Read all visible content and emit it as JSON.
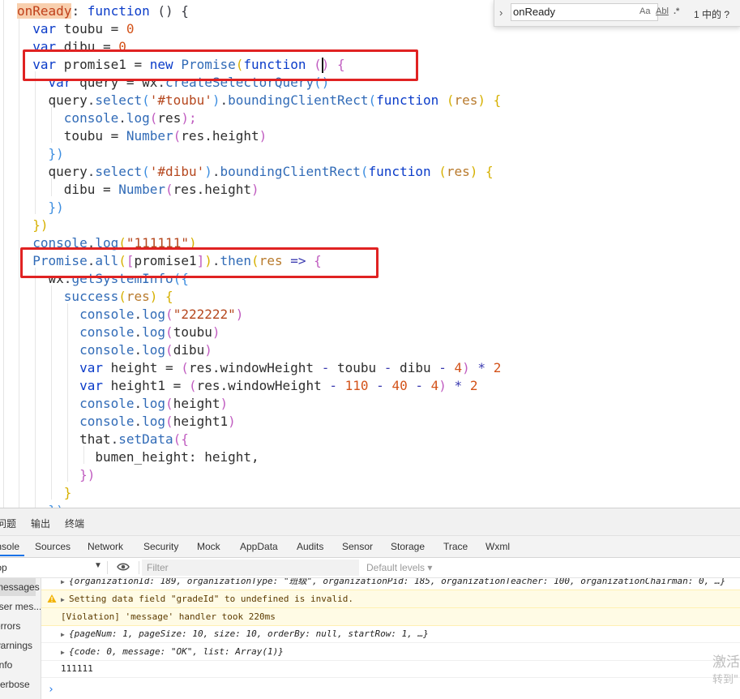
{
  "editor": {
    "lines": [
      [
        {
          "t": "onReady",
          "c": "hl"
        },
        {
          "t": ": ",
          "c": "punc"
        },
        {
          "t": "function",
          "c": "kw"
        },
        {
          "t": " () {",
          "c": "punc"
        }
      ],
      [
        {
          "t": "  ",
          "c": "punc"
        },
        {
          "t": "var",
          "c": "kw"
        },
        {
          "t": " toubu = ",
          "c": "var"
        },
        {
          "t": "0",
          "c": "num"
        }
      ],
      [
        {
          "t": "  ",
          "c": "punc"
        },
        {
          "t": "var",
          "c": "kw"
        },
        {
          "t": " dibu = ",
          "c": "var"
        },
        {
          "t": "0",
          "c": "num"
        }
      ],
      [
        {
          "t": "  ",
          "c": "punc"
        },
        {
          "t": "var",
          "c": "kw"
        },
        {
          "t": " promise1 = ",
          "c": "var"
        },
        {
          "t": "new",
          "c": "kw"
        },
        {
          "t": " ",
          "c": "punc"
        },
        {
          "t": "Promise",
          "c": "fn"
        },
        {
          "t": "(",
          "c": "br1"
        },
        {
          "t": "function",
          "c": "kw"
        },
        {
          "t": " (",
          "c": "br2"
        },
        {
          "t": "CURSOR",
          "c": "cursor"
        },
        {
          "t": ")",
          "c": "br2"
        },
        {
          "t": " {",
          "c": "br2"
        }
      ],
      [
        {
          "t": "    ",
          "c": "punc"
        },
        {
          "t": "var",
          "c": "kw"
        },
        {
          "t": " query = ",
          "c": "var"
        },
        {
          "t": "wx",
          "c": "var"
        },
        {
          "t": ".",
          "c": "punc"
        },
        {
          "t": "createSelectorQuery",
          "c": "fn"
        },
        {
          "t": "()",
          "c": "br3"
        }
      ],
      [
        {
          "t": "    ",
          "c": "punc"
        },
        {
          "t": "query",
          "c": "var"
        },
        {
          "t": ".",
          "c": "punc"
        },
        {
          "t": "select",
          "c": "fn"
        },
        {
          "t": "(",
          "c": "br3"
        },
        {
          "t": "'#toubu'",
          "c": "str"
        },
        {
          "t": ")",
          "c": "br3"
        },
        {
          "t": ".",
          "c": "punc"
        },
        {
          "t": "boundingClientRect",
          "c": "fn"
        },
        {
          "t": "(",
          "c": "br3"
        },
        {
          "t": "function",
          "c": "kw"
        },
        {
          "t": " (",
          "c": "br1"
        },
        {
          "t": "res",
          "c": "prm"
        },
        {
          "t": ")",
          "c": "br1"
        },
        {
          "t": " {",
          "c": "br1"
        }
      ],
      [
        {
          "t": "      ",
          "c": "punc"
        },
        {
          "t": "console",
          "c": "fn"
        },
        {
          "t": ".",
          "c": "punc"
        },
        {
          "t": "log",
          "c": "fn"
        },
        {
          "t": "(",
          "c": "br2"
        },
        {
          "t": "res",
          "c": "var"
        },
        {
          "t": ");",
          "c": "br2"
        }
      ],
      [
        {
          "t": "      ",
          "c": "punc"
        },
        {
          "t": "toubu = ",
          "c": "var"
        },
        {
          "t": "Number",
          "c": "fn"
        },
        {
          "t": "(",
          "c": "br2"
        },
        {
          "t": "res.height",
          "c": "var"
        },
        {
          "t": ")",
          "c": "br2"
        }
      ],
      [
        {
          "t": "    ",
          "c": "punc"
        },
        {
          "t": "})",
          "c": "br3"
        }
      ],
      [
        {
          "t": "    ",
          "c": "punc"
        },
        {
          "t": "query",
          "c": "var"
        },
        {
          "t": ".",
          "c": "punc"
        },
        {
          "t": "select",
          "c": "fn"
        },
        {
          "t": "(",
          "c": "br3"
        },
        {
          "t": "'#dibu'",
          "c": "str"
        },
        {
          "t": ")",
          "c": "br3"
        },
        {
          "t": ".",
          "c": "punc"
        },
        {
          "t": "boundingClientRect",
          "c": "fn"
        },
        {
          "t": "(",
          "c": "br3"
        },
        {
          "t": "function",
          "c": "kw"
        },
        {
          "t": " (",
          "c": "br1"
        },
        {
          "t": "res",
          "c": "prm"
        },
        {
          "t": ")",
          "c": "br1"
        },
        {
          "t": " {",
          "c": "br1"
        }
      ],
      [
        {
          "t": "      ",
          "c": "punc"
        },
        {
          "t": "dibu = ",
          "c": "var"
        },
        {
          "t": "Number",
          "c": "fn"
        },
        {
          "t": "(",
          "c": "br2"
        },
        {
          "t": "res.height",
          "c": "var"
        },
        {
          "t": ")",
          "c": "br2"
        }
      ],
      [
        {
          "t": "    ",
          "c": "punc"
        },
        {
          "t": "})",
          "c": "br3"
        }
      ],
      [
        {
          "t": "  ",
          "c": "punc"
        },
        {
          "t": "})",
          "c": "br1"
        }
      ],
      [
        {
          "t": "  ",
          "c": "punc"
        },
        {
          "t": "console",
          "c": "fn"
        },
        {
          "t": ".",
          "c": "punc"
        },
        {
          "t": "log",
          "c": "fn"
        },
        {
          "t": "(",
          "c": "br1"
        },
        {
          "t": "\"111111\"",
          "c": "str"
        },
        {
          "t": ")",
          "c": "br1"
        }
      ],
      [
        {
          "t": "  ",
          "c": "punc"
        },
        {
          "t": "Promise",
          "c": "fn"
        },
        {
          "t": ".",
          "c": "punc"
        },
        {
          "t": "all",
          "c": "fn"
        },
        {
          "t": "(",
          "c": "br1"
        },
        {
          "t": "[",
          "c": "br2"
        },
        {
          "t": "promise1",
          "c": "var"
        },
        {
          "t": "]",
          "c": "br2"
        },
        {
          "t": ")",
          "c": "br1"
        },
        {
          "t": ".",
          "c": "punc"
        },
        {
          "t": "then",
          "c": "fn"
        },
        {
          "t": "(",
          "c": "br1"
        },
        {
          "t": "res",
          "c": "prm"
        },
        {
          "t": " => ",
          "c": "op"
        },
        {
          "t": "{",
          "c": "br2"
        }
      ],
      [
        {
          "t": "    ",
          "c": "punc"
        },
        {
          "t": "wx",
          "c": "var"
        },
        {
          "t": ".",
          "c": "punc"
        },
        {
          "t": "getSystemInfo",
          "c": "fn"
        },
        {
          "t": "({",
          "c": "br3"
        }
      ],
      [
        {
          "t": "      ",
          "c": "punc"
        },
        {
          "t": "success",
          "c": "fn"
        },
        {
          "t": "(",
          "c": "br1"
        },
        {
          "t": "res",
          "c": "prm"
        },
        {
          "t": ")",
          "c": "br1"
        },
        {
          "t": " {",
          "c": "br1"
        }
      ],
      [
        {
          "t": "        ",
          "c": "punc"
        },
        {
          "t": "console",
          "c": "fn"
        },
        {
          "t": ".",
          "c": "punc"
        },
        {
          "t": "log",
          "c": "fn"
        },
        {
          "t": "(",
          "c": "br2"
        },
        {
          "t": "\"222222\"",
          "c": "str"
        },
        {
          "t": ")",
          "c": "br2"
        }
      ],
      [
        {
          "t": "        ",
          "c": "punc"
        },
        {
          "t": "console",
          "c": "fn"
        },
        {
          "t": ".",
          "c": "punc"
        },
        {
          "t": "log",
          "c": "fn"
        },
        {
          "t": "(",
          "c": "br2"
        },
        {
          "t": "toubu",
          "c": "var"
        },
        {
          "t": ")",
          "c": "br2"
        }
      ],
      [
        {
          "t": "        ",
          "c": "punc"
        },
        {
          "t": "console",
          "c": "fn"
        },
        {
          "t": ".",
          "c": "punc"
        },
        {
          "t": "log",
          "c": "fn"
        },
        {
          "t": "(",
          "c": "br2"
        },
        {
          "t": "dibu",
          "c": "var"
        },
        {
          "t": ")",
          "c": "br2"
        }
      ],
      [
        {
          "t": "        ",
          "c": "punc"
        },
        {
          "t": "var",
          "c": "kw"
        },
        {
          "t": " height = ",
          "c": "var"
        },
        {
          "t": "(",
          "c": "br2"
        },
        {
          "t": "res.windowHeight ",
          "c": "var"
        },
        {
          "t": "-",
          "c": "op"
        },
        {
          "t": " toubu ",
          "c": "var"
        },
        {
          "t": "-",
          "c": "op"
        },
        {
          "t": " dibu ",
          "c": "var"
        },
        {
          "t": "-",
          "c": "op"
        },
        {
          "t": " ",
          "c": "punc"
        },
        {
          "t": "4",
          "c": "num"
        },
        {
          "t": ")",
          "c": "br2"
        },
        {
          "t": " * ",
          "c": "op"
        },
        {
          "t": "2",
          "c": "num"
        }
      ],
      [
        {
          "t": "        ",
          "c": "punc"
        },
        {
          "t": "var",
          "c": "kw"
        },
        {
          "t": " height1 = ",
          "c": "var"
        },
        {
          "t": "(",
          "c": "br2"
        },
        {
          "t": "res.windowHeight ",
          "c": "var"
        },
        {
          "t": "-",
          "c": "op"
        },
        {
          "t": " ",
          "c": "punc"
        },
        {
          "t": "110",
          "c": "num"
        },
        {
          "t": " ",
          "c": "punc"
        },
        {
          "t": "-",
          "c": "op"
        },
        {
          "t": " ",
          "c": "punc"
        },
        {
          "t": "40",
          "c": "num"
        },
        {
          "t": " ",
          "c": "punc"
        },
        {
          "t": "-",
          "c": "op"
        },
        {
          "t": " ",
          "c": "punc"
        },
        {
          "t": "4",
          "c": "num"
        },
        {
          "t": ")",
          "c": "br2"
        },
        {
          "t": " * ",
          "c": "op"
        },
        {
          "t": "2",
          "c": "num"
        }
      ],
      [
        {
          "t": "        ",
          "c": "punc"
        },
        {
          "t": "console",
          "c": "fn"
        },
        {
          "t": ".",
          "c": "punc"
        },
        {
          "t": "log",
          "c": "fn"
        },
        {
          "t": "(",
          "c": "br2"
        },
        {
          "t": "height",
          "c": "var"
        },
        {
          "t": ")",
          "c": "br2"
        }
      ],
      [
        {
          "t": "        ",
          "c": "punc"
        },
        {
          "t": "console",
          "c": "fn"
        },
        {
          "t": ".",
          "c": "punc"
        },
        {
          "t": "log",
          "c": "fn"
        },
        {
          "t": "(",
          "c": "br2"
        },
        {
          "t": "height1",
          "c": "var"
        },
        {
          "t": ")",
          "c": "br2"
        }
      ],
      [
        {
          "t": "        ",
          "c": "punc"
        },
        {
          "t": "that",
          "c": "var"
        },
        {
          "t": ".",
          "c": "punc"
        },
        {
          "t": "setData",
          "c": "fn"
        },
        {
          "t": "({",
          "c": "br2"
        }
      ],
      [
        {
          "t": "          ",
          "c": "punc"
        },
        {
          "t": "bumen_height",
          "c": "var"
        },
        {
          "t": ": height,",
          "c": "var"
        }
      ],
      [
        {
          "t": "        ",
          "c": "punc"
        },
        {
          "t": "})",
          "c": "br2"
        }
      ],
      [
        {
          "t": "      ",
          "c": "punc"
        },
        {
          "t": "}",
          "c": "br1"
        }
      ],
      [
        {
          "t": "    ",
          "c": "punc"
        },
        {
          "t": "})",
          "c": "br3"
        }
      ]
    ]
  },
  "find": {
    "query": "onReady",
    "opt_case": "Aa",
    "opt_word": "Abl",
    "opt_regex": ".*",
    "result": "1 中的 ?"
  },
  "devtools": {
    "panel_tabs": [
      "问题",
      "输出",
      "终端"
    ],
    "tool_tabs": [
      "Console",
      "Sources",
      "Network",
      "Security",
      "Mock",
      "AppData",
      "Audits",
      "Sensor",
      "Storage",
      "Trace",
      "Wxml"
    ],
    "context": "top",
    "filter_placeholder": "Filter",
    "levels": "Default levels ▾",
    "sidebar": [
      "messages",
      "user mes...",
      "errors",
      "warnings",
      "info",
      "verbose"
    ],
    "console": {
      "row1": "{organizationId: 189, organizationType: \"班级\", organizationPid: 185, organizationTeacher: 100, organizationChairman: 0, …}",
      "row2": "Setting data field \"gradeId\" to undefined is invalid.",
      "row3": "[Violation] 'message' handler took 220ms",
      "row4": "{pageNum: 1, pageSize: 10, size: 10, orderBy: null, startRow: 1, …}",
      "row5": "{code: 0, message: \"OK\", list: Array(1)}",
      "row6": "111111",
      "prompt": "›"
    },
    "watermark": [
      "激活",
      "转到\""
    ]
  },
  "colors": {
    "highlight_red": "#e02222",
    "warning_bg": "#fffbe5",
    "accent": "#1a73e8"
  }
}
